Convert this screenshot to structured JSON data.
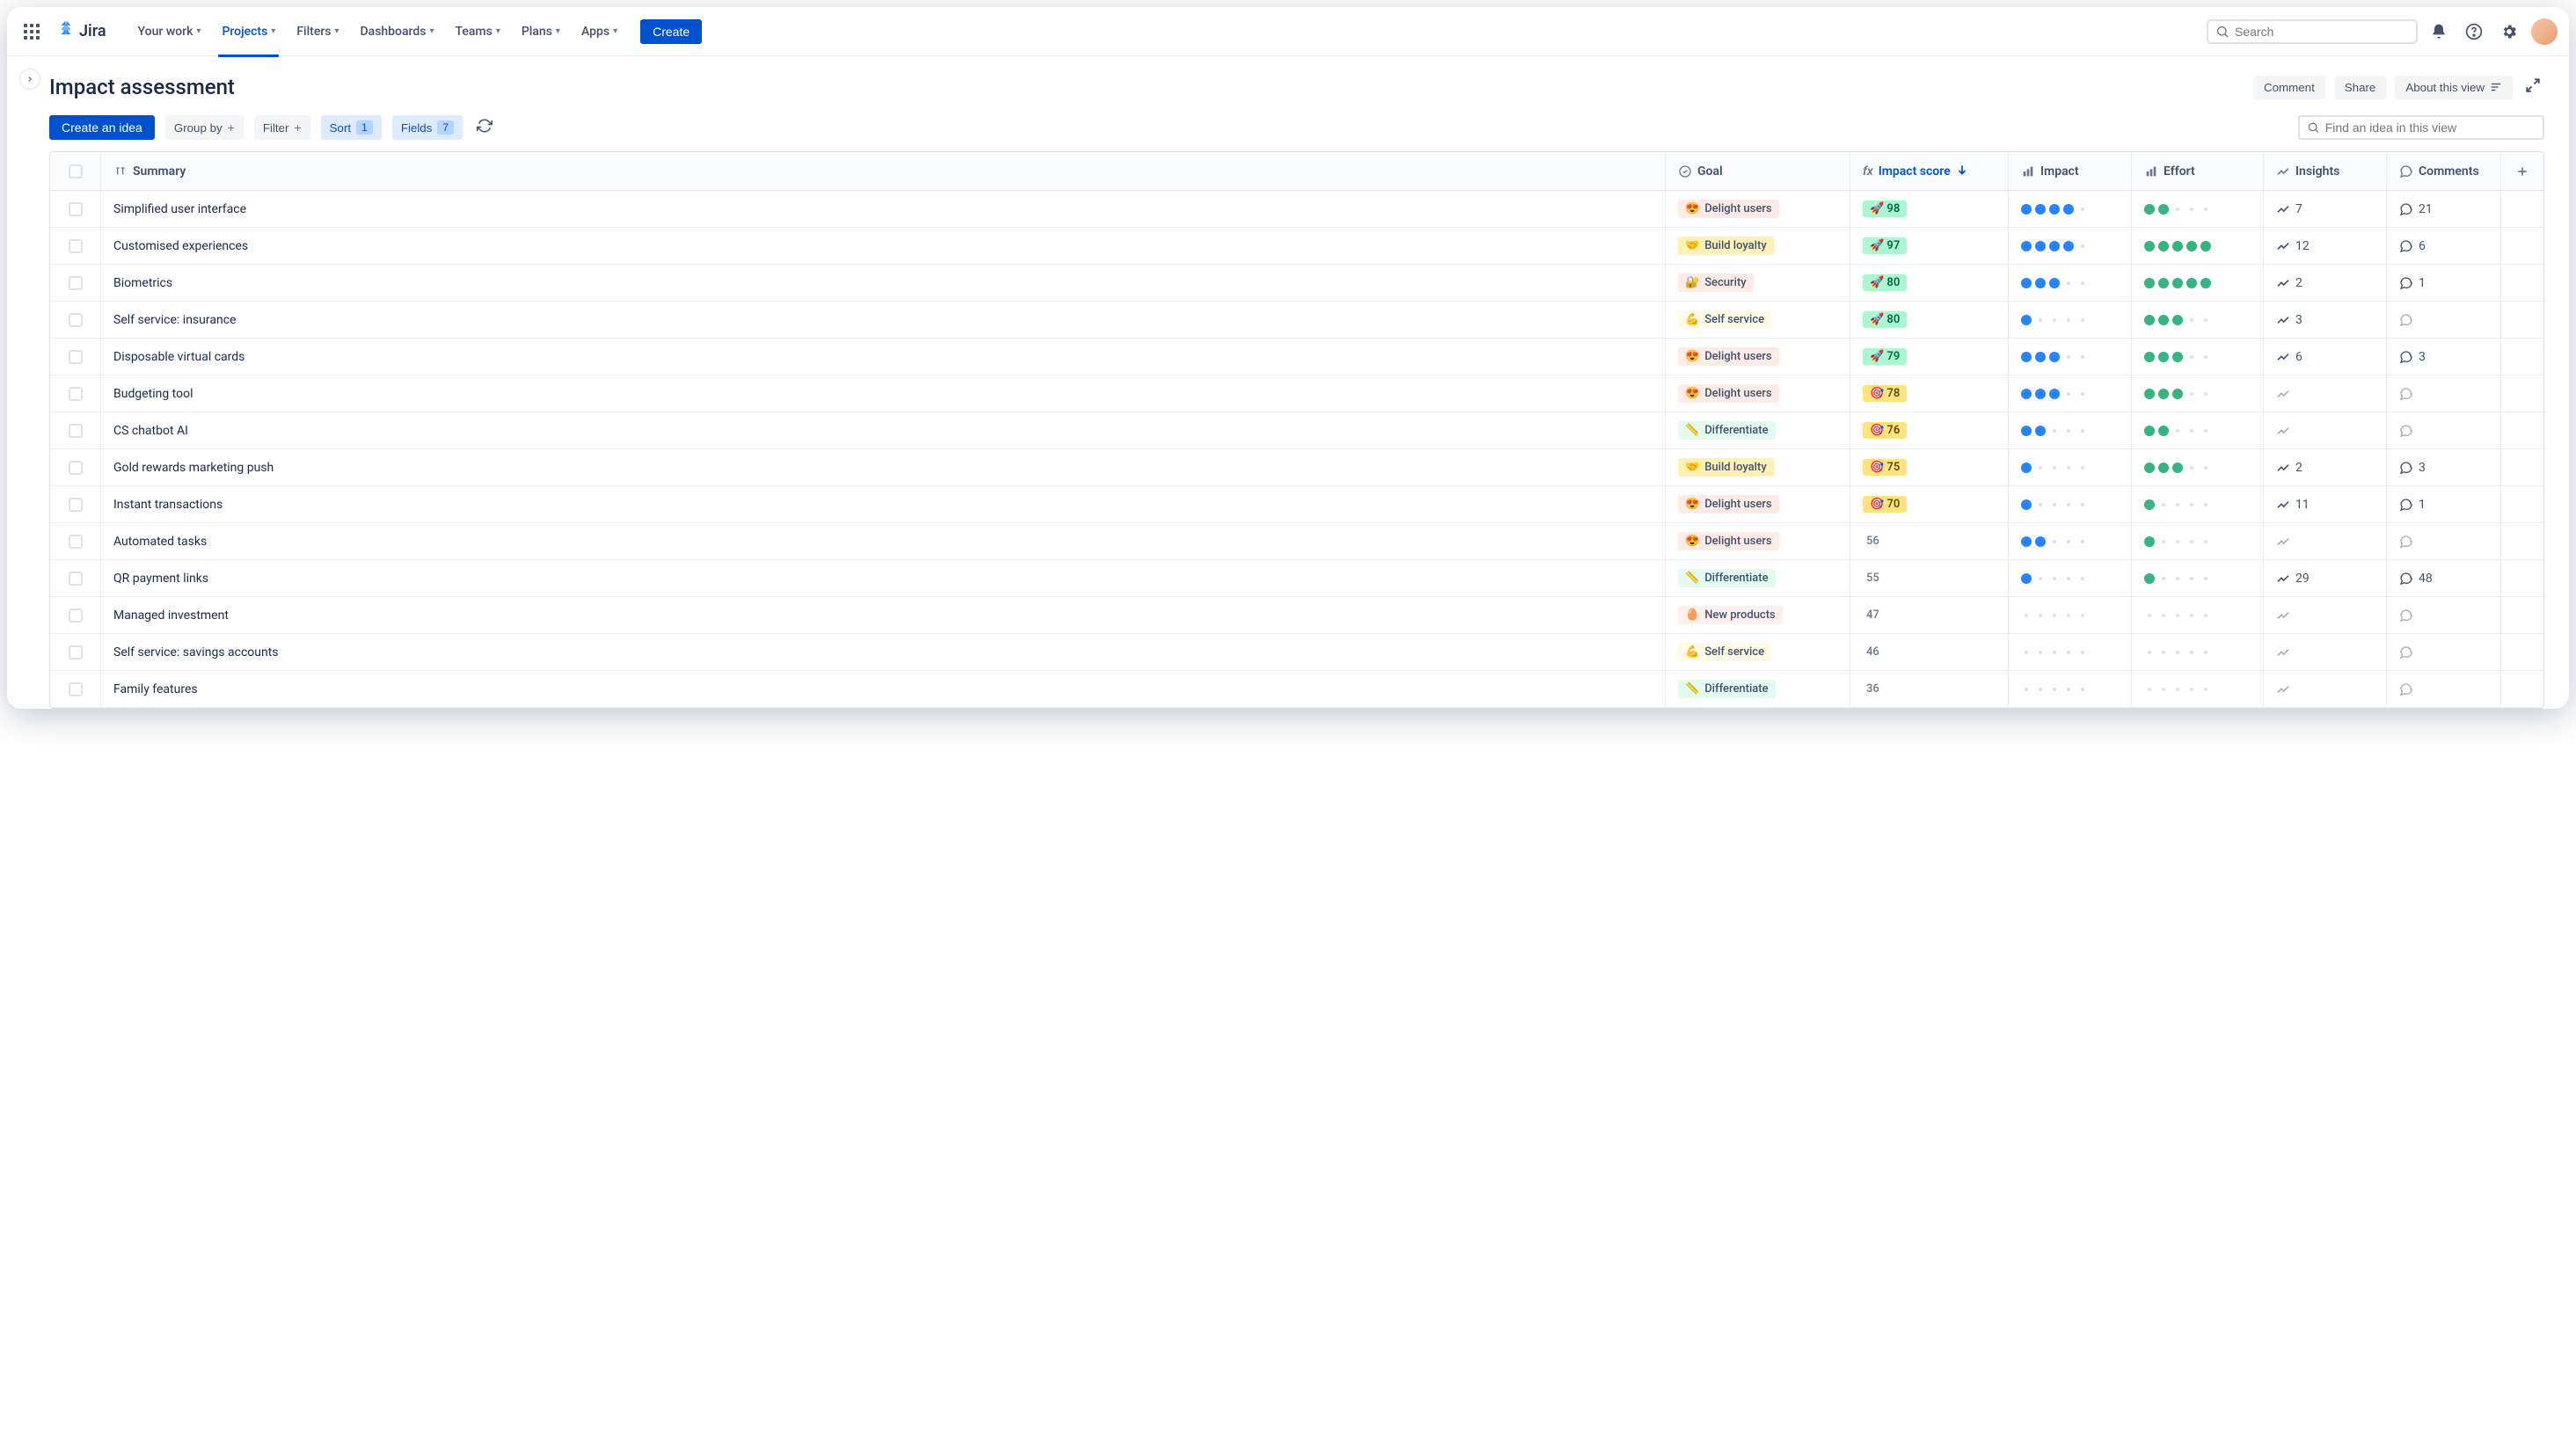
{
  "app": {
    "name": "Jira"
  },
  "nav": {
    "items": [
      {
        "label": "Your work"
      },
      {
        "label": "Projects",
        "active": true
      },
      {
        "label": "Filters"
      },
      {
        "label": "Dashboards"
      },
      {
        "label": "Teams"
      },
      {
        "label": "Plans"
      },
      {
        "label": "Apps"
      }
    ],
    "create_label": "Create",
    "search_placeholder": "Search"
  },
  "page": {
    "title": "Impact assessment",
    "actions": {
      "comment": "Comment",
      "share": "Share",
      "about": "About this view"
    }
  },
  "toolbar": {
    "create_idea": "Create an idea",
    "group_by": "Group by",
    "filter": "Filter",
    "sort": "Sort",
    "sort_badge": "1",
    "fields": "Fields",
    "fields_badge": "7",
    "search_placeholder": "Find an idea in this view"
  },
  "columns": {
    "summary": "Summary",
    "goal": "Goal",
    "impact_score": "Impact score",
    "impact": "Impact",
    "effort": "Effort",
    "insights": "Insights",
    "comments": "Comments"
  },
  "goals": {
    "delight": {
      "emoji": "😍",
      "label": "Delight users",
      "cls": "delight"
    },
    "loyalty": {
      "emoji": "🤝",
      "label": "Build loyalty",
      "cls": "loyalty"
    },
    "security": {
      "emoji": "🔐",
      "label": "Security",
      "cls": "security"
    },
    "selfservice": {
      "emoji": "💪",
      "label": "Self service",
      "cls": "selfservice"
    },
    "diff": {
      "emoji": "📏",
      "label": "Differentiate",
      "cls": "diff"
    },
    "newprod": {
      "emoji": "🥚",
      "label": "New products",
      "cls": "newprod"
    }
  },
  "rows": [
    {
      "summary": "Simplified user interface",
      "goal": "delight",
      "score": 98,
      "score_tier": "green",
      "impact": 4,
      "effort": 2,
      "insights": 7,
      "comments": 21
    },
    {
      "summary": "Customised experiences",
      "goal": "loyalty",
      "score": 97,
      "score_tier": "green",
      "impact": 4,
      "effort": 5,
      "insights": 12,
      "comments": 6
    },
    {
      "summary": "Biometrics",
      "goal": "security",
      "score": 80,
      "score_tier": "green",
      "impact": 3,
      "effort": 5,
      "insights": 2,
      "comments": 1
    },
    {
      "summary": "Self service: insurance",
      "goal": "selfservice",
      "score": 80,
      "score_tier": "green",
      "impact": 1,
      "effort": 3,
      "insights": 3,
      "comments": null
    },
    {
      "summary": "Disposable virtual cards",
      "goal": "delight",
      "score": 79,
      "score_tier": "green",
      "impact": 3,
      "effort": 3,
      "insights": 6,
      "comments": 3
    },
    {
      "summary": "Budgeting tool",
      "goal": "delight",
      "score": 78,
      "score_tier": "yellow",
      "impact": 3,
      "effort": 3,
      "insights": null,
      "comments": null
    },
    {
      "summary": "CS chatbot AI",
      "goal": "diff",
      "score": 76,
      "score_tier": "yellow",
      "impact": 2,
      "effort": 2,
      "insights": null,
      "comments": null
    },
    {
      "summary": "Gold rewards marketing push",
      "goal": "loyalty",
      "score": 75,
      "score_tier": "yellow",
      "impact": 1,
      "effort": 3,
      "insights": 2,
      "comments": 3
    },
    {
      "summary": "Instant transactions",
      "goal": "delight",
      "score": 70,
      "score_tier": "yellow",
      "impact": 1,
      "effort": 1,
      "insights": 11,
      "comments": 1
    },
    {
      "summary": "Automated tasks",
      "goal": "delight",
      "score": 56,
      "score_tier": "plain",
      "impact": 2,
      "effort": 1,
      "insights": null,
      "comments": null
    },
    {
      "summary": "QR payment links",
      "goal": "diff",
      "score": 55,
      "score_tier": "plain",
      "impact": 1,
      "effort": 1,
      "insights": 29,
      "comments": 48
    },
    {
      "summary": "Managed investment",
      "goal": "newprod",
      "score": 47,
      "score_tier": "plain",
      "impact": 0,
      "effort": 0,
      "insights": null,
      "comments": null
    },
    {
      "summary": "Self service: savings accounts",
      "goal": "selfservice",
      "score": 46,
      "score_tier": "plain",
      "impact": 0,
      "effort": 0,
      "insights": null,
      "comments": null
    },
    {
      "summary": "Family features",
      "goal": "diff",
      "score": 36,
      "score_tier": "plain",
      "impact": 0,
      "effort": 0,
      "insights": null,
      "comments": null
    }
  ]
}
